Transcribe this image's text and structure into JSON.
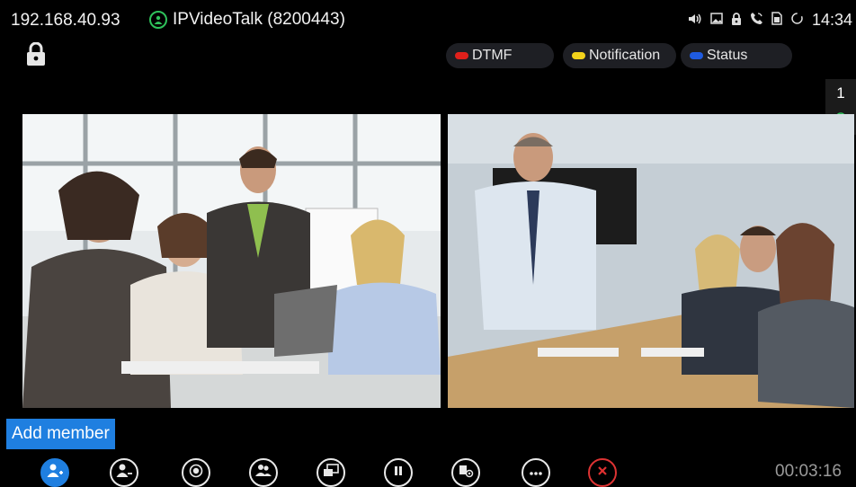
{
  "status_bar": {
    "ip_address": "192.168.40.93",
    "account": "IPVideoTalk (8200443)",
    "time": "14:34",
    "icons": [
      "speaker-icon",
      "image-icon",
      "lock-icon",
      "call-icon",
      "sim-icon",
      "sync-icon"
    ]
  },
  "chips": [
    {
      "label": "DTMF",
      "color": "#e0201b"
    },
    {
      "label": "Notification",
      "color": "#f2d21b"
    },
    {
      "label": "Status",
      "color": "#1f5be0"
    }
  ],
  "layout_badge": {
    "number": "1"
  },
  "videos": [
    {
      "scene": "office-team-meeting",
      "participants": 5
    },
    {
      "scene": "conference-room-meeting",
      "participants": 5
    }
  ],
  "toolbar": {
    "tooltip": "Add member",
    "buttons": [
      {
        "icon": "add-member-icon",
        "active": true
      },
      {
        "icon": "remove-member-icon"
      },
      {
        "icon": "record-icon"
      },
      {
        "icon": "members-icon"
      },
      {
        "icon": "layout-icon"
      },
      {
        "icon": "pause-icon"
      },
      {
        "icon": "camera-settings-icon"
      },
      {
        "icon": "more-icon"
      },
      {
        "icon": "end-call-icon"
      }
    ],
    "call_duration": "00:03:16"
  },
  "colors": {
    "accent": "#1f7fe0",
    "account_green": "#2fc25b",
    "end_red": "#d33333"
  }
}
